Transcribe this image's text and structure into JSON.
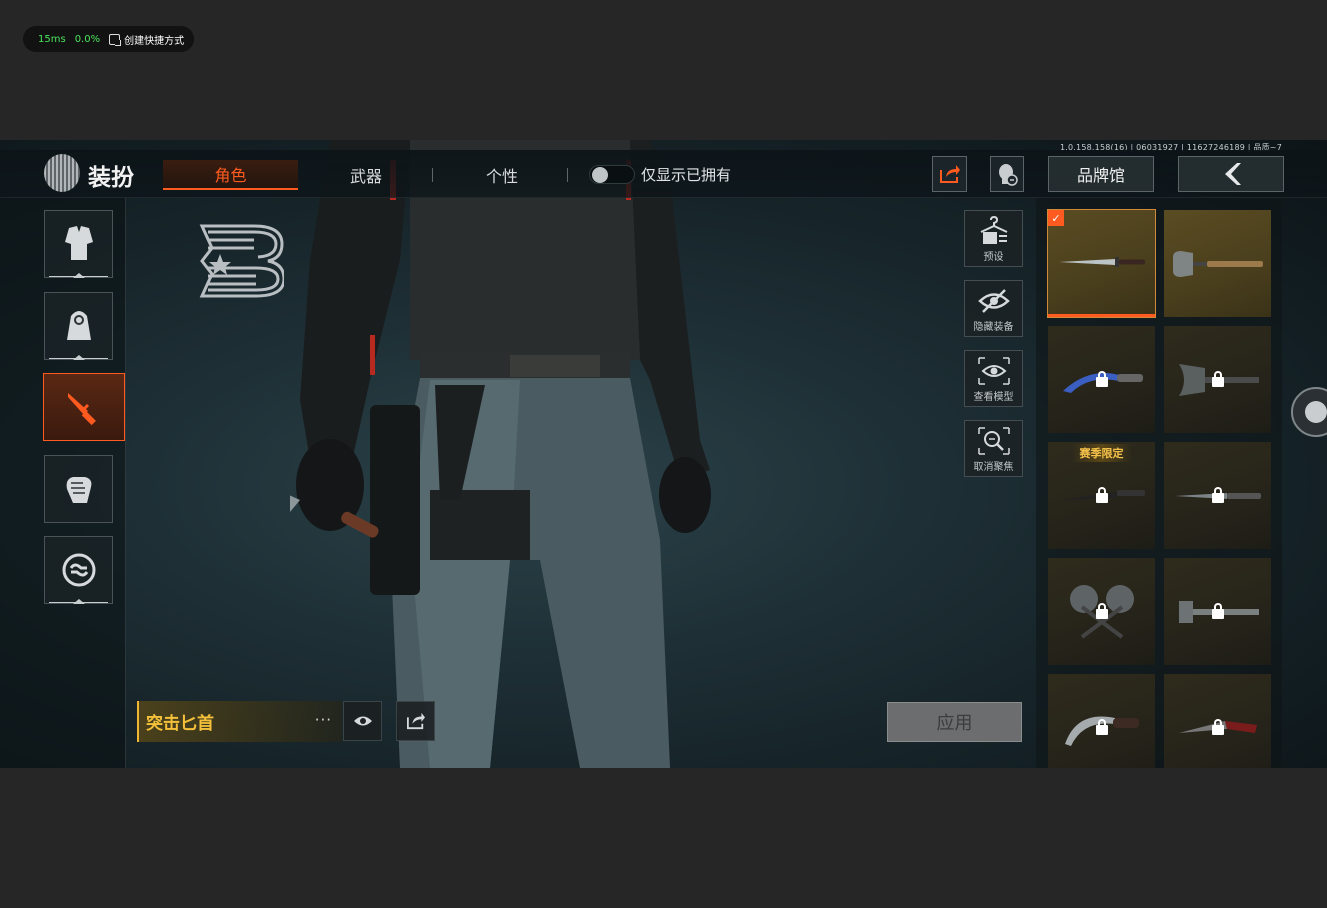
{
  "overlay": {
    "latency": "15ms",
    "loss": "0.0%",
    "shortcut_label": "创建快捷方式"
  },
  "game": {
    "version": "1.0.158.158(16) | 06031927 | 11627246189 | 品质~7",
    "title": "装扮",
    "tabs": [
      {
        "label": "角色",
        "active": true
      },
      {
        "label": "武器",
        "active": false
      },
      {
        "label": "个性",
        "active": false
      }
    ],
    "toggle_label": "仅显示已拥有",
    "brand_label": "品牌馆",
    "actions": [
      {
        "label": "预设",
        "icon": "hanger-icon"
      },
      {
        "label": "隐藏装备",
        "icon": "eye-off-icon"
      },
      {
        "label": "查看模型",
        "icon": "eye-icon"
      },
      {
        "label": "取消聚焦",
        "icon": "zoom-out-icon"
      }
    ],
    "item_name": "突击匕首",
    "more": "···",
    "apply_label": "应用",
    "grid_items": [
      {
        "name": "dagger",
        "selected": true,
        "locked": false,
        "gold": true
      },
      {
        "name": "shovel",
        "selected": false,
        "locked": false,
        "gold": true
      },
      {
        "name": "karambit-blue",
        "selected": false,
        "locked": true,
        "gold": false
      },
      {
        "name": "axe",
        "selected": false,
        "locked": true,
        "gold": false
      },
      {
        "name": "sword-limited",
        "selected": false,
        "locked": true,
        "gold": false,
        "tag": "赛季限定"
      },
      {
        "name": "blade",
        "selected": false,
        "locked": true,
        "gold": false
      },
      {
        "name": "double-axe",
        "selected": false,
        "locked": true,
        "gold": false
      },
      {
        "name": "hammer",
        "selected": false,
        "locked": true,
        "gold": false
      },
      {
        "name": "karambit",
        "selected": false,
        "locked": true,
        "gold": false
      },
      {
        "name": "red-blade",
        "selected": false,
        "locked": true,
        "gold": false
      }
    ],
    "colors": {
      "accent": "#ff5a1f",
      "gold": "#f5c13a"
    }
  }
}
